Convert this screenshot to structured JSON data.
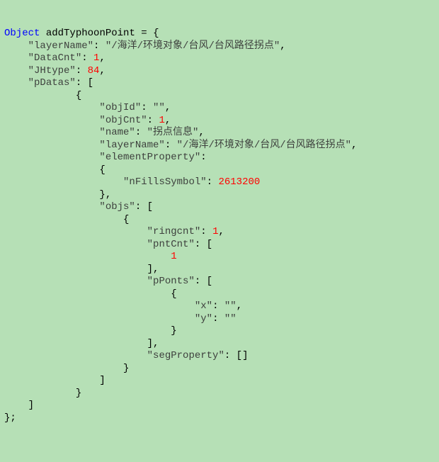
{
  "code": {
    "keyword": "Object",
    "varName": "addTyphoonPoint",
    "assign": " = {",
    "layerName_key": "\"layerName\"",
    "layerName_val": "\"/海洋/环境对象/台风/台风路径拐点\"",
    "DataCnt_key": "\"DataCnt\"",
    "DataCnt_val": "1",
    "JHtype_key": "\"JHtype\"",
    "JHtype_val": "84",
    "pDatas_key": "\"pDatas\"",
    "pDatas_open": ": [",
    "open_brace": "{",
    "objId_key": "\"objId\"",
    "objId_val": "\"\"",
    "objCnt_key": "\"objCnt\"",
    "objCnt_val": "1",
    "name_key": "\"name\"",
    "name_val": "\"拐点信息\"",
    "elementProperty_key": "\"elementProperty\"",
    "nFillsSymbol_key": "\"nFillsSymbol\"",
    "nFillsSymbol_val": "2613200",
    "close_brace_comma": "},",
    "objs_key": "\"objs\"",
    "objs_open": ": [",
    "ringcnt_key": "\"ringcnt\"",
    "ringcnt_val": "1",
    "pntCnt_key": "\"pntCnt\"",
    "pntCnt_open": ": [",
    "pntCnt_val": "1",
    "close_bracket_comma": "],",
    "pPonts_key": "\"pPonts\"",
    "pPonts_open": ": [",
    "x_key": "\"x\"",
    "x_val": "\"\"",
    "y_key": "\"y\"",
    "y_val": "\"\"",
    "close_brace": "}",
    "segProperty_key": "\"segProperty\"",
    "segProperty_val": ": []",
    "close_bracket": "]",
    "end": "};"
  }
}
